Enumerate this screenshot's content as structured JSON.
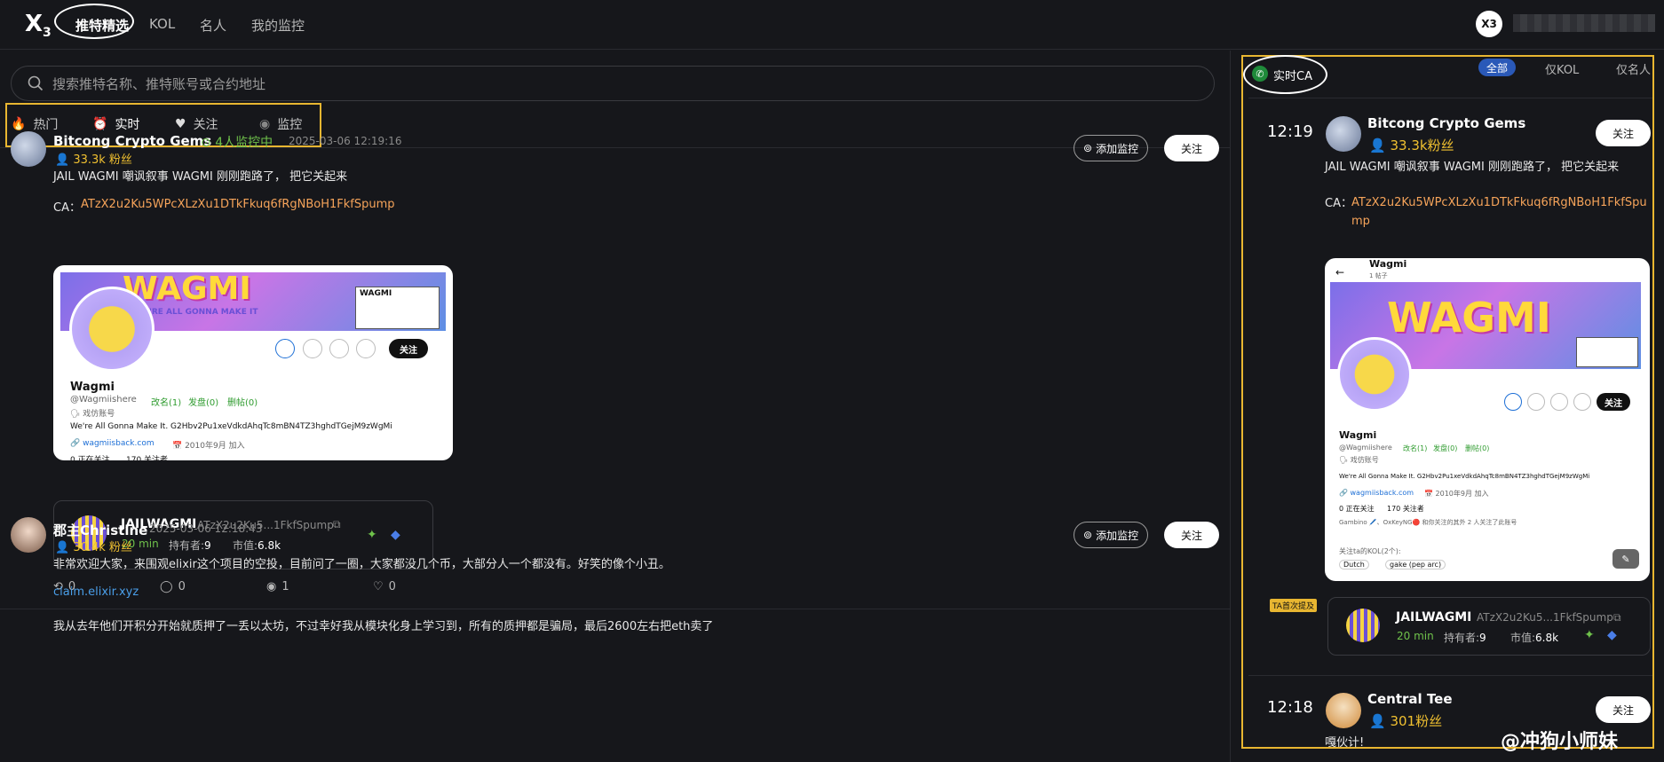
{
  "nav": {
    "logo": "X",
    "logo_sub": "3",
    "tabs": [
      "推特精选",
      "KOL",
      "名人",
      "我的监控"
    ],
    "user_avatar": "X3"
  },
  "search": {
    "placeholder": "搜索推特名称、推特账号或合约地址"
  },
  "filters": [
    {
      "label": "热门",
      "icon": "fire-icon"
    },
    {
      "label": "实时",
      "icon": "alarm-clock-icon"
    },
    {
      "label": "关注",
      "icon": "heart-icon"
    },
    {
      "label": "监控",
      "icon": "radar-icon"
    }
  ],
  "actions": {
    "monitor": "添加监控",
    "follow": "关注"
  },
  "posts": [
    {
      "name": "Bitcong Crypto Gems",
      "monitor": "4人监控中",
      "time": "2025-03-06 12:19:16",
      "fans": "33.3k 粉丝",
      "text": "JAIL WAGMI  嘲讽叙事    WAGMI  刚刚跑路了， 把它关起来",
      "ca_label": "CA：",
      "ca": "ATzX2u2Ku5WPcXLzXu1DTkFkuq6fRgNBoH1FkfSpump",
      "card": {
        "banner": "WAGMI",
        "banner_sub": "WE'RE ALL GONNA MAKE IT",
        "mini_title": "WAGMI",
        "follow": "关注",
        "name": "Wagmi",
        "handle": "@Wagmiishere",
        "renamed": "改名(1)",
        "posts_count": "发盘(0)",
        "deleted": "删帖(0)",
        "tag": "戏仿账号",
        "bio": "We're All Gonna Make It. G2Hbv2Pu1xeVdkdAhqTc8mBN4TZ3hghdTGejM9zWgMi",
        "site": "wagmiisback.com",
        "joined": "2010年9月 加入",
        "following": "0 正在关注",
        "followers": "170 关注者"
      },
      "token": {
        "name": "JAILWAGMI",
        "ca": "ATzX2u2Ku5...1FkfSpump",
        "age": "20 min",
        "holders_label": "持有者:",
        "holders": "9",
        "mcap_label": "市值:",
        "mcap": "6.8k"
      },
      "stats": {
        "retweets": "0",
        "replies": "0",
        "views": "1",
        "likes": "0"
      }
    },
    {
      "name": "郡主Christine",
      "time": "2025-03-06 12:18:43",
      "fans": "30.4k 粉丝",
      "text": "非常欢迎大家，来围观elixir这个项目的空投，目前问了一圈，大家都没几个币，大部分人一个都没有。好笑的像个小丑。",
      "link": "claim.elixir.xyz",
      "text2": "我从去年他们开积分开始就质押了一丢以太坊，不过幸好我从模块化身上学习到，所有的质押都是骗局，最后2600左右把eth卖了"
    }
  ],
  "realtime": {
    "title": "实时CA",
    "tabs": [
      "全部",
      "仅KOL",
      "仅名人"
    ],
    "items": [
      {
        "time": "12:19",
        "name": "Bitcong Crypto Gems",
        "fans": "33.3k粉丝",
        "text": "JAIL WAGMI  嘲讽叙事    WAGMI  刚刚跑路了， 把它关起来",
        "ca_label": "CA：",
        "ca": "ATzX2u2Ku5WPcXLzXu1DTkFkuq6fRgNBoH1FkfSpump",
        "card": {
          "header_name": "Wagmi",
          "header_sub": "1 帖子",
          "banner": "WAGMI",
          "name": "Wagmi",
          "handle": "@Wagmiishere",
          "renamed": "改名(1)",
          "posts_count": "发盘(0)",
          "deleted": "删帖(0)",
          "tag": "戏仿账号",
          "bio": "We're All Gonna Make It. G2Hbv2Pu1xeVdkdAhqTc8mBN4TZ3hghdTGejM9zWgMi",
          "site": "wagmiisback.com",
          "joined": "2010年9月 加入",
          "following": "0 正在关注",
          "followers": "170 关注者",
          "mutuals": "Gambino 🖊️、OxKeyNG🔴 和你关注的其外 2 人关注了此账号",
          "kol_label": "关注ta的KOL(2个):",
          "kols": [
            "Dutch",
            "gake (pep arc)"
          ],
          "follow": "关注"
        },
        "badge": "TA首次提及",
        "token": {
          "name": "JAILWAGMI",
          "ca": "ATzX2u2Ku5...1FkfSpump",
          "age": "20 min",
          "holders_label": "持有者:",
          "holders": "9",
          "mcap_label": "市值:",
          "mcap": "6.8k"
        }
      },
      {
        "time": "12:18",
        "name": "Central Tee",
        "fans": "301粉丝",
        "text": "嘎伙计!"
      }
    ]
  },
  "watermark": "@冲狗小师妹",
  "colors": {
    "bg": "#16171b",
    "accent": "#e8b631",
    "ca": "#f6a45a",
    "green": "#6fc24b",
    "fans": "#f0c030",
    "link": "#4a9ee8"
  }
}
